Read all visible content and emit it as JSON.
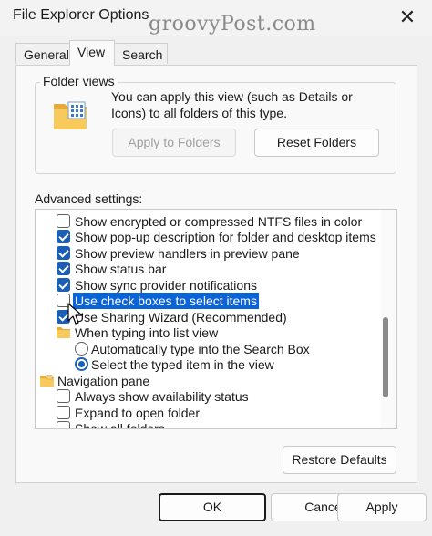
{
  "window": {
    "title": "File Explorer Options",
    "watermark": "groovyPost.com"
  },
  "tabs": [
    {
      "label": "General",
      "active": false
    },
    {
      "label": "View",
      "active": true
    },
    {
      "label": "Search",
      "active": false
    }
  ],
  "folder_views": {
    "label": "Folder views",
    "description": "You can apply this view (such as Details or Icons) to all folders of this type.",
    "apply_label": "Apply to Folders",
    "reset_label": "Reset Folders"
  },
  "advanced": {
    "label": "Advanced settings:",
    "items": [
      {
        "text": "Show encrypted or compressed NTFS files in color",
        "type": "checkbox",
        "checked": false
      },
      {
        "text": "Show pop-up description for folder and desktop items",
        "type": "checkbox",
        "checked": true
      },
      {
        "text": "Show preview handlers in preview pane",
        "type": "checkbox",
        "checked": true
      },
      {
        "text": "Show status bar",
        "type": "checkbox",
        "checked": true
      },
      {
        "text": "Show sync provider notifications",
        "type": "checkbox",
        "checked": true
      },
      {
        "text": "Use check boxes to select items",
        "type": "checkbox",
        "checked": false,
        "selected": true
      },
      {
        "text": "Use Sharing Wizard (Recommended)",
        "type": "checkbox",
        "checked": true
      },
      {
        "text": "When typing into list view",
        "type": "folder"
      },
      {
        "text": "Automatically type into the Search Box",
        "type": "radio",
        "checked": false
      },
      {
        "text": "Select the typed item in the view",
        "type": "radio",
        "checked": true
      },
      {
        "text": "Navigation pane",
        "type": "folder"
      },
      {
        "text": "Always show availability status",
        "type": "checkbox",
        "checked": false
      },
      {
        "text": "Expand to open folder",
        "type": "checkbox",
        "checked": false
      },
      {
        "text": "Show all folders",
        "type": "checkbox",
        "checked": false
      }
    ],
    "restore_label": "Restore Defaults"
  },
  "footer": {
    "ok_label": "OK",
    "cancel_label": "Cancel",
    "apply_label": "Apply"
  },
  "colors": {
    "accent": "#1a5fb4",
    "selection": "#0a64d8"
  }
}
